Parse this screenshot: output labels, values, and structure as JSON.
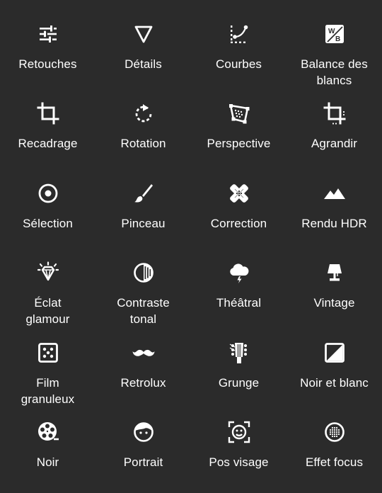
{
  "background": "#2b2b2b",
  "tools": [
    {
      "label": "Retouches",
      "icon": "tune-sliders-icon"
    },
    {
      "label": "Détails",
      "icon": "triangle-down-icon"
    },
    {
      "label": "Courbes",
      "icon": "curves-icon"
    },
    {
      "label": "Balance des\nblancs",
      "icon": "white-balance-icon"
    },
    {
      "label": "Recadrage",
      "icon": "crop-icon"
    },
    {
      "label": "Rotation",
      "icon": "rotate-icon"
    },
    {
      "label": "Perspective",
      "icon": "perspective-icon"
    },
    {
      "label": "Agrandir",
      "icon": "expand-icon"
    },
    {
      "label": "Sélection",
      "icon": "target-icon"
    },
    {
      "label": "Pinceau",
      "icon": "brush-icon"
    },
    {
      "label": "Correction",
      "icon": "bandage-icon"
    },
    {
      "label": "Rendu HDR",
      "icon": "mountains-icon"
    },
    {
      "label": "Éclat\nglamour",
      "icon": "diamond-icon"
    },
    {
      "label": "Contraste\ntonal",
      "icon": "tonal-contrast-icon"
    },
    {
      "label": "Théâtral",
      "icon": "storm-cloud-icon"
    },
    {
      "label": "Vintage",
      "icon": "lamp-icon"
    },
    {
      "label": "Film\ngranuleux",
      "icon": "dice-icon"
    },
    {
      "label": "Retrolux",
      "icon": "mustache-icon"
    },
    {
      "label": "Grunge",
      "icon": "guitar-head-icon"
    },
    {
      "label": "Noir et blanc",
      "icon": "black-white-icon"
    },
    {
      "label": "Noir",
      "icon": "film-reel-icon"
    },
    {
      "label": "Portrait",
      "icon": "face-icon"
    },
    {
      "label": "Pos visage",
      "icon": "face-frame-icon"
    },
    {
      "label": "Effet focus",
      "icon": "focus-dots-icon"
    }
  ]
}
